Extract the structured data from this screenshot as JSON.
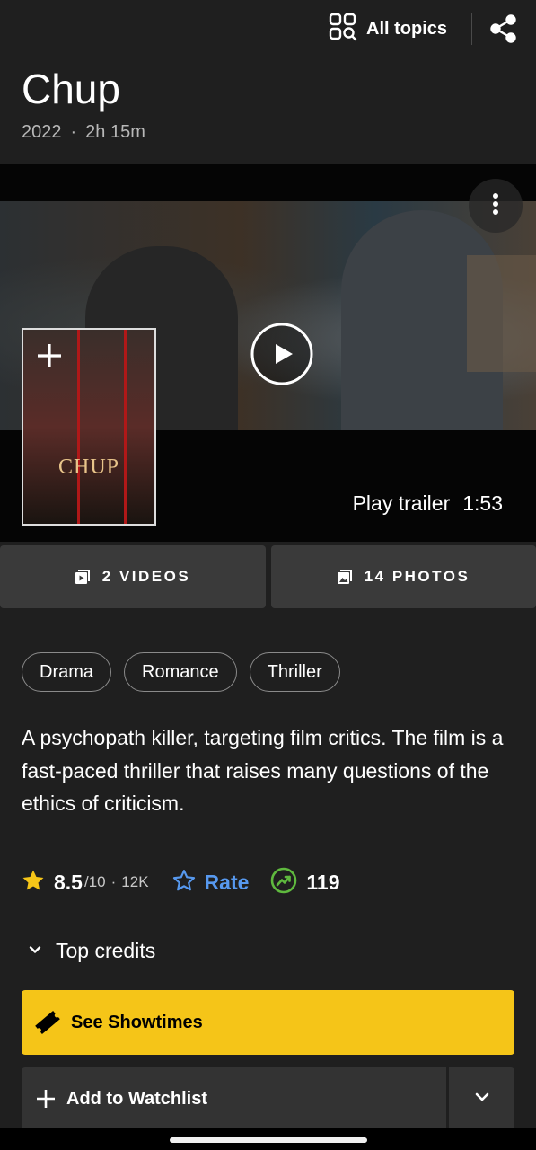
{
  "header": {
    "all_topics_label": "All topics",
    "share_icon": "share-icon",
    "grid_icon": "grid-search-icon"
  },
  "movie": {
    "title": "Chup",
    "year": "2022",
    "separator": "·",
    "runtime": "2h 15m",
    "poster_title": "CHUP"
  },
  "media": {
    "trailer_label": "Play trailer",
    "trailer_duration": "1:53"
  },
  "tiles": {
    "videos_label": "2 VIDEOS",
    "photos_label": "14 PHOTOS"
  },
  "genres": [
    "Drama",
    "Romance",
    "Thriller"
  ],
  "description": "A psychopath killer, targeting film critics. The film is a fast-paced thriller that raises many questions of the ethics of criticism.",
  "ratings": {
    "value": "8.5",
    "out_of": "/10",
    "separator": "·",
    "count": "12K",
    "rate_label": "Rate",
    "popularity": "119"
  },
  "credits": {
    "label": "Top credits"
  },
  "actions": {
    "showtimes_label": "See Showtimes",
    "watchlist_label": "Add to Watchlist"
  },
  "colors": {
    "background": "#1f1f1f",
    "accent_yellow": "#f5c518",
    "rate_blue": "#5799ef",
    "trend_green": "#5fb93e"
  }
}
